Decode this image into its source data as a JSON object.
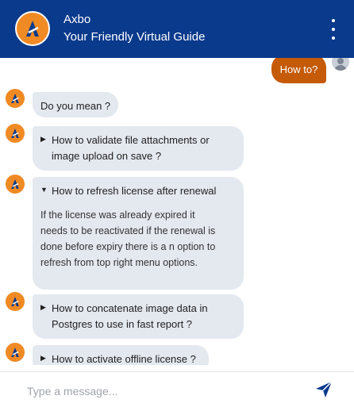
{
  "header": {
    "title": "Axbo",
    "subtitle": "Your Friendly Virtual Guide",
    "menu_icon": "kebab-menu-icon",
    "brand_color": "#0a3a8c",
    "accent_color": "#f08a24"
  },
  "user_message": {
    "text": "How to?",
    "bubble_color": "#c55a08"
  },
  "bot_messages": {
    "prompt": "Do you mean ?",
    "suggestions": [
      {
        "expanded": false,
        "caret": "▶",
        "line1": "How to validate file attachments or",
        "line2": "image upload on save ?"
      },
      {
        "expanded": true,
        "caret": "▼",
        "line1": "How to refresh license after renewal",
        "answer": [
          "If the license was already expired it",
          "needs to be reactivated if the renewal is",
          "done before expiry there is a n option to",
          "refresh from top right menu options."
        ]
      },
      {
        "expanded": false,
        "caret": "▶",
        "line1": "How to concatenate image data in",
        "line2": "Postgres to use in fast report ?"
      },
      {
        "expanded": false,
        "caret": "▶",
        "line1": "How to activate offline license ?"
      }
    ]
  },
  "composer": {
    "placeholder": "Type a message...",
    "send_icon": "send-icon"
  }
}
